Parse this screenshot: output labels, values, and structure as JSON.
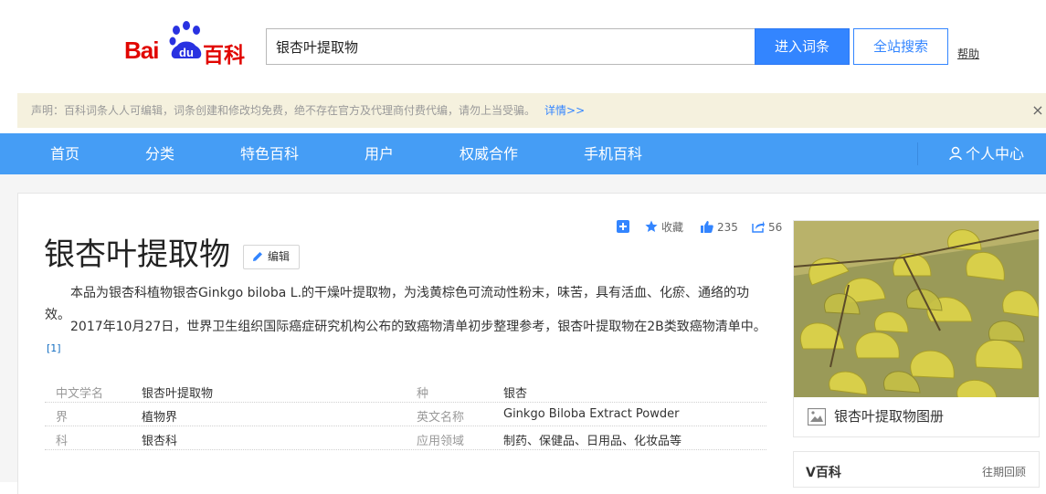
{
  "header": {
    "logo_bai": "Bai",
    "logo_du": "du",
    "logo_baike": "百科",
    "search_value": "银杏叶提取物",
    "enter_label": "进入词条",
    "site_search_label": "全站搜索",
    "help_label": "帮助"
  },
  "notice": {
    "text": "声明：百科词条人人可编辑，词条创建和修改均免费，绝不存在官方及代理商付费代编，请勿上当受骗。",
    "more": "详情>>",
    "close": "×"
  },
  "nav": {
    "items": [
      "首页",
      "分类",
      "特色百科",
      "用户",
      "权威合作",
      "手机百科"
    ],
    "user_center": "个人中心"
  },
  "tools": {
    "collect": "收藏",
    "likes": "235",
    "shares": "56"
  },
  "entry": {
    "title": "银杏叶提取物",
    "edit_label": "编辑",
    "summary": "本品为银杏科植物银杏Ginkgo biloba L.的干燥叶提取物，为浅黄棕色可流动性粉末，味苦，具有活血、化瘀、通络的功效。",
    "note": "2017年10月27日，世界卫生组织国际癌症研究机构公布的致癌物清单初步整理参考，银杏叶提取物在2B类致癌物清单中。",
    "ref": "[1]"
  },
  "basic_info": [
    {
      "l1": "中文学名",
      "v1": "银杏叶提取物",
      "l2": "种",
      "v2": "银杏"
    },
    {
      "l1": "界",
      "v1": "植物界",
      "l2": "英文名称",
      "v2": "Ginkgo Biloba Extract Powder"
    },
    {
      "l1": "科",
      "v1": "银杏科",
      "l2": "应用领域",
      "v2": "制药、保健品、日用品、化妆品等"
    }
  ],
  "sidebar": {
    "album_label": "银杏叶提取物图册",
    "v_title": "V百科",
    "v_more": "往期回顾"
  },
  "colors": {
    "accent": "#3385ff",
    "nav": "#459df5",
    "brand_red": "#e10601",
    "notice_bg": "#f5f1de"
  }
}
